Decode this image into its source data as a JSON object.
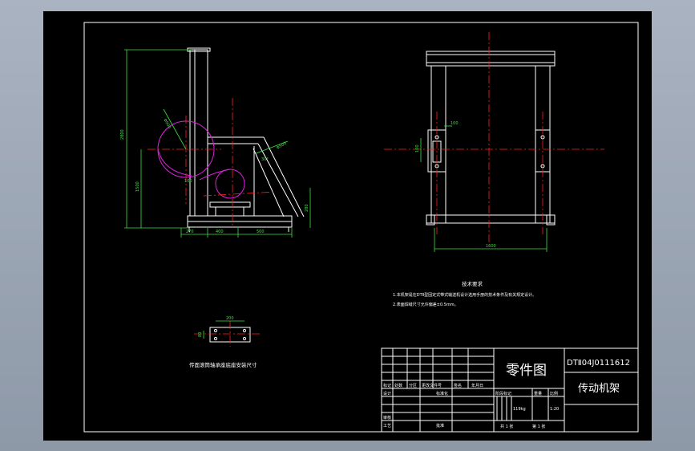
{
  "side_view": {
    "dims": {
      "height_total": "2800",
      "height_frame": "1500",
      "base_left": "270",
      "base_mid": "400",
      "base_right": "500",
      "top_bar": "100",
      "right_height": "280",
      "angle": "30°",
      "dia_big": "Φ900",
      "dia_small": "Φ500"
    }
  },
  "front_view": {
    "dims": {
      "width": "1600",
      "plate_h": "100",
      "plate_w": "100"
    }
  },
  "tech_req": {
    "title": "技术要求",
    "line1": "1.本机架是在DTⅡ型固定式带式输送机设计选用手册的技术条件及有关规定设计。",
    "line2": "2.表面焊缝尺寸允许偏差±0.5mm。"
  },
  "detail": {
    "caption": "传面滚筒轴承座底座安装尺寸",
    "dims": {
      "a": "200",
      "b": "80"
    }
  },
  "title_block": {
    "part_type": "零件图",
    "drawing_no": "DTⅡ04J0111612",
    "part_name": "传动机架",
    "row_labels": {
      "mark": "标记",
      "count": "处数",
      "zone": "分区",
      "change_doc": "更改文件号",
      "sign": "签名",
      "date": "年月日"
    },
    "labels": {
      "design": "设计",
      "standard": "标准化",
      "review": "审核",
      "process": "工艺",
      "approve": "批准"
    },
    "stage_labels": {
      "stage": "阶段标记",
      "weight": "重量",
      "scale": "比例"
    },
    "weight": "119kg",
    "scale": "1:20",
    "sheets": "共 1 张",
    "sheet_no": "第 1 张"
  }
}
